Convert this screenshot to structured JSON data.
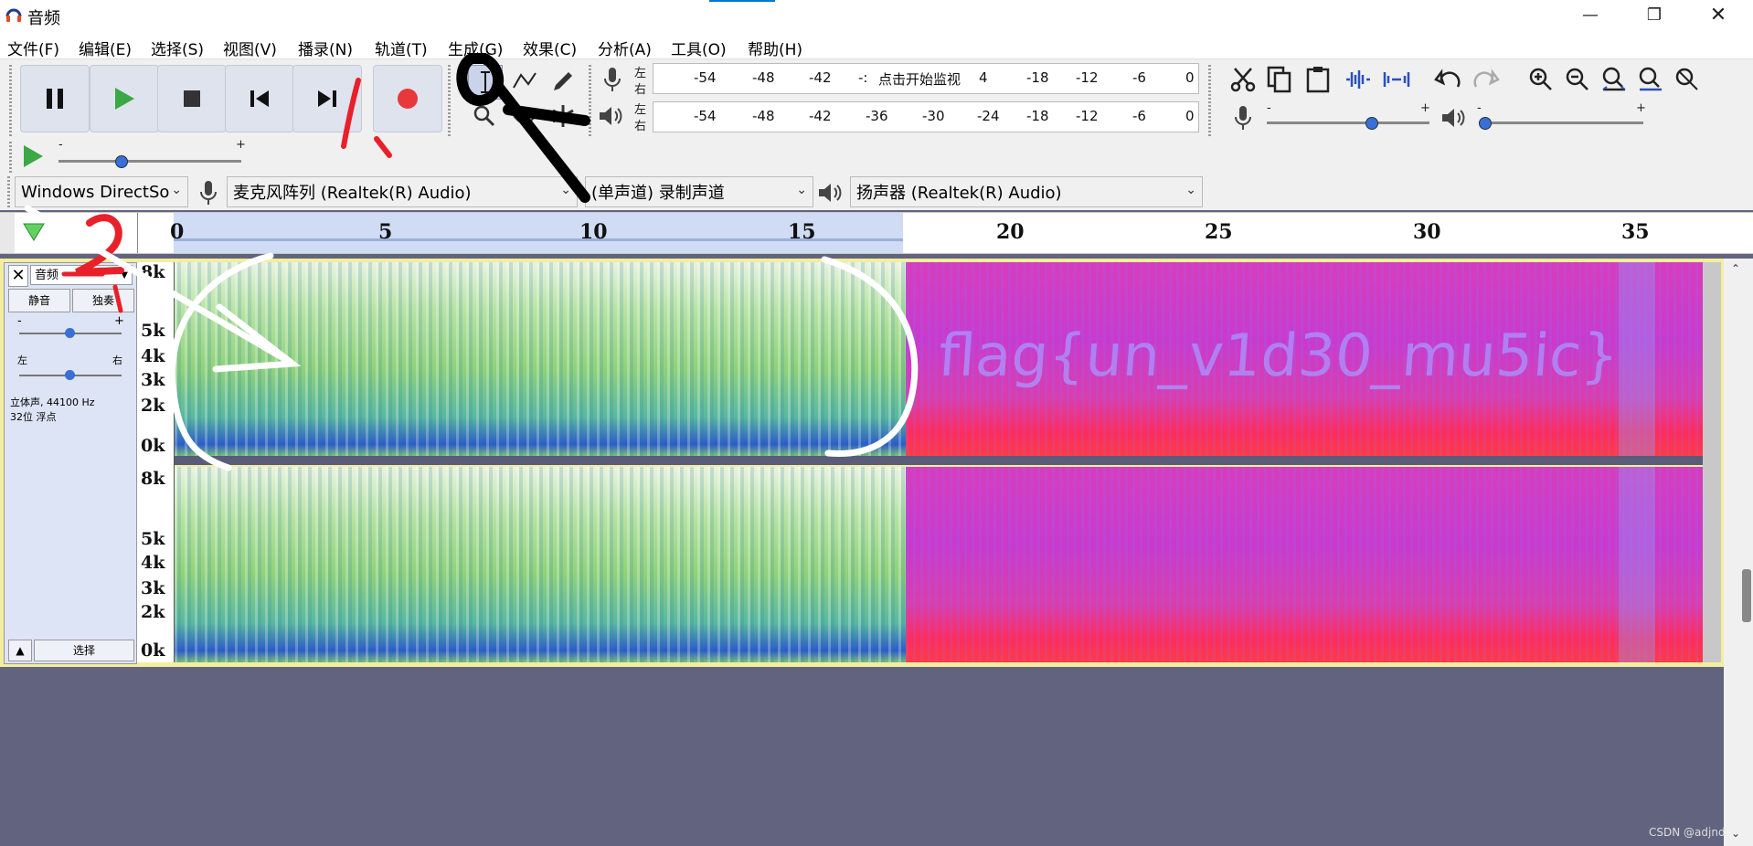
{
  "window": {
    "title": "音频"
  },
  "menu": [
    "文件(F)",
    "编辑(E)",
    "选择(S)",
    "视图(V)",
    "播录(N)",
    "轨道(T)",
    "生成(G)",
    "效果(C)",
    "分析(A)",
    "工具(O)",
    "帮助(H)"
  ],
  "meters": {
    "record": {
      "channel_l": "左",
      "channel_r": "右",
      "ticks": [
        "-54",
        "-48",
        "-42",
        "-:",
        "4",
        "-18",
        "-12",
        "-6",
        "0"
      ],
      "hint": "点击开始监视"
    },
    "play": {
      "channel_l": "左",
      "channel_r": "右",
      "ticks": [
        "-54",
        "-48",
        "-42",
        "-36",
        "-30",
        "-24",
        "-18",
        "-12",
        "-6",
        "0"
      ]
    }
  },
  "sliders": {
    "mic_min": "-",
    "mic_max": "+",
    "mic_level": 0.65,
    "speaker_min": "-",
    "speaker_max": "+",
    "speaker_level": 0.0,
    "speed_min": "-",
    "speed_max": "+",
    "speed_level": 0.33
  },
  "device": {
    "host": "Windows DirectSo",
    "input": "麦克风阵列 (Realtek(R) Audio)",
    "channels": "(单声道) 录制声道",
    "output": "扬声器 (Realtek(R) Audio)"
  },
  "timeline": {
    "ticks": [
      "0",
      "5",
      "10",
      "15",
      "20",
      "25",
      "30",
      "35"
    ]
  },
  "track": {
    "name": "音频",
    "mute": "静音",
    "solo": "独奏",
    "gain_min": "-",
    "gain_max": "+",
    "pan_left": "左",
    "pan_right": "右",
    "info_line1": "立体声, 44100 Hz",
    "info_line2": "32位 浮点",
    "select": "选择",
    "freq_labels_top": [
      "8k",
      "5k",
      "4k",
      "3k",
      "2k",
      "0k"
    ],
    "freq_labels_bottom": [
      "8k",
      "5k",
      "4k",
      "3k",
      "2k",
      "0k"
    ],
    "hidden_message": "flag{un_v1d30_mu5ic}"
  },
  "annotations": {
    "step1": "1",
    "step2": "2"
  },
  "watermark": "CSDN @adjnd",
  "colors": {
    "spectro_green": "#8fd27a",
    "spectro_magenta": "#d23ab8",
    "spectro_red": "#ff2a55",
    "background": "#62647f"
  }
}
